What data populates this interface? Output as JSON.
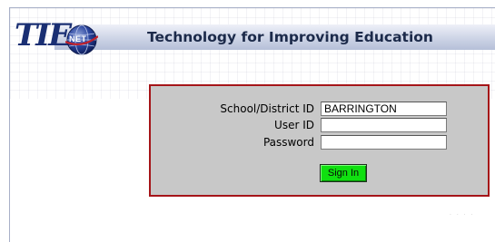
{
  "header": {
    "logo_text": "TIE",
    "logo_badge": "NET",
    "title": "Technology for Improving Education"
  },
  "login": {
    "school_label": "School/District ID",
    "school_value": "BARRINGTON",
    "user_label": "User ID",
    "user_value": "",
    "password_label": "Password",
    "password_value": "",
    "sign_in_label": "Sign In"
  },
  "colors": {
    "brand_navy": "#1a2f73",
    "login_border": "#a51418",
    "login_background": "#c8c8c8",
    "sign_in_button": "#10e010",
    "title_bar": "#cdd4e6"
  },
  "icons": {
    "logo": "globe-icon"
  }
}
